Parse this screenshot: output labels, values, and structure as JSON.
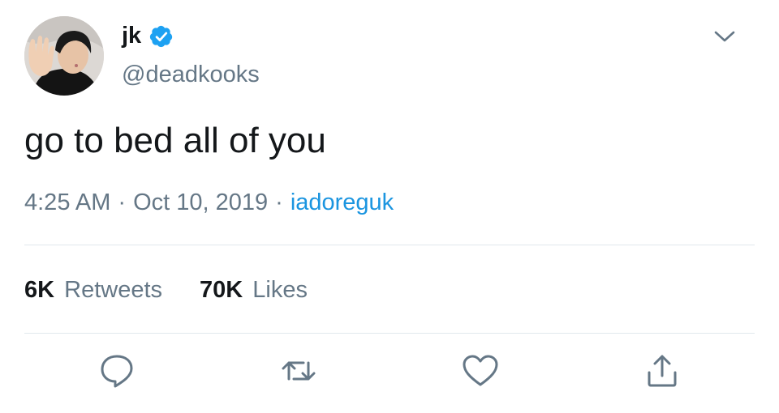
{
  "author": {
    "name": "jk",
    "handle": "@deadkooks",
    "verified": true,
    "avatar_icon": "profile-photo"
  },
  "tweet": {
    "text": "go to bed all of you",
    "time": "4:25 AM",
    "date": "Oct 10, 2019",
    "source": "iadoreguk",
    "separator": "·"
  },
  "stats": {
    "retweets_count": "6K",
    "retweets_label": "Retweets",
    "likes_count": "70K",
    "likes_label": "Likes"
  },
  "actions": [
    "reply-icon",
    "retweet-icon",
    "like-icon",
    "share-icon"
  ],
  "colors": {
    "text": "#14171a",
    "secondary": "#657786",
    "link": "#1b95e0",
    "verified": "#1da1f2",
    "divider": "#e1e8ed"
  }
}
